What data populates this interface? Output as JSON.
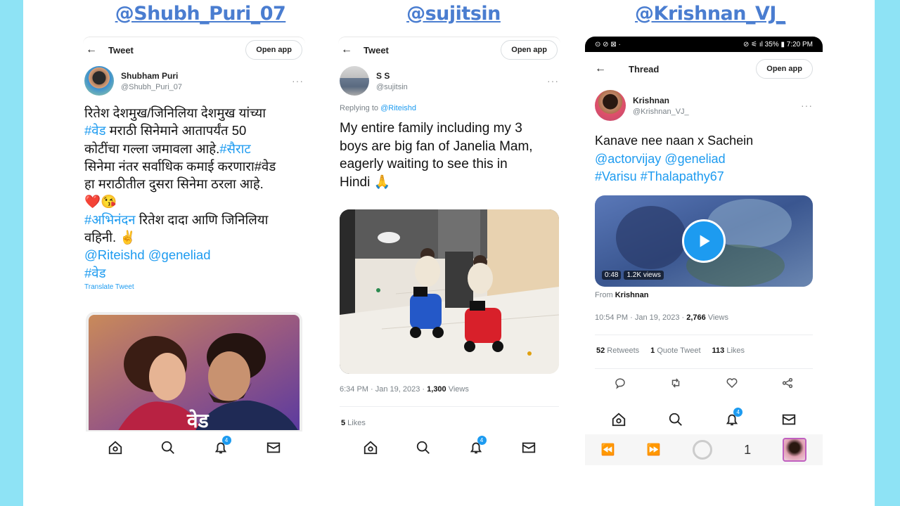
{
  "colors": {
    "side_band": "#8ee3f5",
    "handle": "#4a7dd0",
    "link": "#1d9bf0"
  },
  "handles": [
    "@Shubh_Puri_07",
    "@sujitsin",
    "@Krishnan_VJ_"
  ],
  "tweet1": {
    "topbar_title": "Tweet",
    "open_app": "Open app",
    "author_name": "Shubham Puri",
    "author_handle": "@Shubh_Puri_07",
    "lines": [
      "रितेश देशमुख/जिनिलिया देशमुख यांच्या",
      "#वेड",
      " मराठी सिनेमाने आतापर्यंत 50",
      "कोटींचा गल्ला जमावला आहे.",
      "#सैराट",
      "सिनेमा नंतर सर्वाधिक कमाई करणारा#वेड",
      "हा मराठीतील दुसरा सिनेमा ठरला आहे.",
      "❤️😘",
      "#अभिनंदन",
      " रितेश दादा आणि जिनिलिया",
      "वहिनी. ✌️",
      "@Riteishd @geneliad",
      "#वेड"
    ],
    "translate": "Translate Tweet",
    "poster_title": "वेड",
    "notif_count": "4"
  },
  "tweet2": {
    "topbar_title": "Tweet",
    "open_app": "Open app",
    "author_name": "S S",
    "author_handle": "@sujitsin",
    "replying_prefix": "Replying to",
    "replying_to": "@Riteishd",
    "lines": [
      "My entire family including my 3",
      "boys are big fan of Janelia Mam,",
      "eagerly waiting to see this in",
      "Hindi 🙏"
    ],
    "timestamp": "6:34 PM · Jan 19, 2023 · ",
    "views_count": "1,300",
    "views_label": " Views",
    "likes_count": "5",
    "likes_label": " Likes",
    "notif_count": "4"
  },
  "tweet3": {
    "statusbar_left": "⊙ ⊘ ⊠ ·",
    "statusbar_right": "⊘ ⚟ ıl 35% ▮ 7:20 PM",
    "topbar_title": "Thread",
    "open_app": "Open app",
    "author_name": "Krishnan",
    "author_handle": "@Krishnan_VJ_",
    "line1": "Kanave nee naan x Sachein",
    "line2": "@actorvijay @geneliad",
    "line3": "#Varisu #Thalapathy67",
    "video_duration": "0:48",
    "video_views": "1.2K views",
    "from_label": "From",
    "from_name": "Krishnan",
    "timestamp": "10:54 PM · Jan 19, 2023 · ",
    "views_count": "2,766",
    "views_label": " Views",
    "retweets_count": "52",
    "retweets_label": " Retweets",
    "quotes_count": "1",
    "quotes_label": " Quote Tweet",
    "likes_count": "113",
    "likes_label": " Likes",
    "notif_count": "4",
    "browser_tab_count": "1"
  }
}
